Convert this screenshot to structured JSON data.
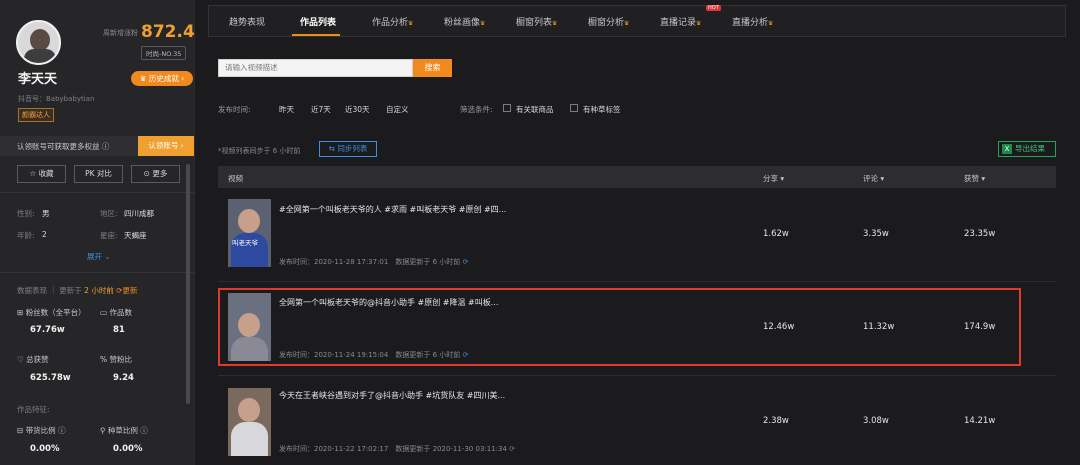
{
  "profile": {
    "rank_label": "周新增涨粉",
    "rank_value": "872.4",
    "rank_pill": "时尚-NO.35",
    "name": "李天天",
    "history_button": "历史成就",
    "uid": "抖音号：Babybabytian",
    "tag": "颜霸达人",
    "auth_text": "认领账号可获取更多权益",
    "auth_button": "认领账号"
  },
  "actions": [
    "收藏",
    "对比",
    "更多"
  ],
  "info": {
    "gender_label": "性别:",
    "gender": "男",
    "region_label": "地区:",
    "region": "四川成都",
    "age_label": "年龄:",
    "age": "2",
    "zodiac_label": "星座:",
    "zodiac": "天蝎座",
    "expand": "展开"
  },
  "stats": {
    "title": "数据表现",
    "updated_prefix": "更新于",
    "updated_time": "2 小时前",
    "update_action": "更新",
    "fans_label": "粉丝数（全平台）",
    "fans": "67.76w",
    "works_label": "作品数",
    "works": "81",
    "likes_label": "总获赞",
    "likes": "625.78w",
    "ratio_label": "赞粉比",
    "ratio": "9.24",
    "features_label": "作品特征:",
    "goods_label": "带货比例",
    "goods": "0.00%",
    "grass_label": "种草比例",
    "grass": "0.00%"
  },
  "tabs": [
    "趋势表现",
    "作品列表",
    "作品分析",
    "粉丝画像",
    "橱窗列表",
    "橱窗分析",
    "直播记录",
    "直播分析"
  ],
  "hot_badge": "HOT",
  "search": {
    "placeholder": "请输入视频描述",
    "button": "搜索"
  },
  "filters": {
    "time_label": "发布时间:",
    "times": [
      "昨天",
      "近7天",
      "近30天",
      "自定义"
    ],
    "cond_label": "筛选条件:",
    "cond1": "有关联商品",
    "cond2": "有种草标签"
  },
  "sync_note": "*视频列表同步于 6 小时前",
  "sync_button": "同步列表",
  "export_button": "导出结果",
  "table": {
    "headers": [
      "视频",
      "分享",
      "评论",
      "获赞"
    ],
    "rows": [
      {
        "title": "#全网第一个叫板老天爷的人 #求雨 #叫板老天爷 #原创 #四...",
        "published": "发布时间：2020-11-28 17:37:01",
        "updated": "数据更新于 6 小时前",
        "thumb_caption": "叫老天爷",
        "share": "1.62w",
        "comment": "3.35w",
        "likes": "23.35w"
      },
      {
        "title": "全网第一个叫板老天爷的@抖音小助手 #原创 #降温 #叫板...",
        "published": "发布时间：2020-11-24 19:15:04",
        "updated": "数据更新于 6 小时前",
        "thumb_caption": "",
        "share": "12.46w",
        "comment": "11.32w",
        "likes": "174.9w"
      },
      {
        "title": "今天在王者峡谷遇到对手了@抖音小助手 #坑货队友 #四川美...",
        "published": "发布时间：2020-11-22 17:02:17",
        "updated": "数据更新于 2020-11-30 03:11:34",
        "thumb_caption": "",
        "share": "2.38w",
        "comment": "3.08w",
        "likes": "14.21w"
      }
    ]
  }
}
